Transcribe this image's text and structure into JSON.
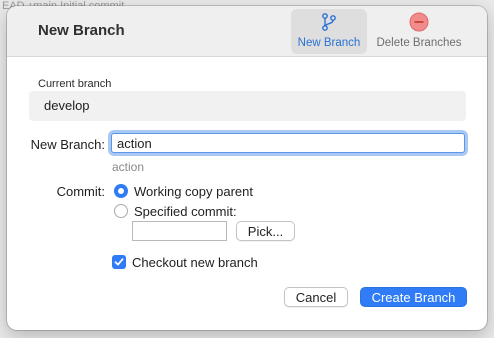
{
  "background": {
    "text": "EAD  ↑main  Initial commit"
  },
  "dialog": {
    "title": "New Branch",
    "toolbar": [
      {
        "label": "New Branch",
        "icon": "branch-icon",
        "active": true
      },
      {
        "label": "Delete Branches",
        "icon": "delete-circle-icon",
        "active": false
      }
    ]
  },
  "current_branch": {
    "label": "Current branch",
    "value": "develop"
  },
  "new_branch": {
    "label": "New Branch:",
    "value": "action",
    "hint": "action"
  },
  "commit": {
    "label": "Commit:",
    "options": [
      {
        "label": "Working copy parent",
        "selected": true
      },
      {
        "label": "Specified commit:",
        "selected": false
      }
    ],
    "commit_value": "",
    "pick_label": "Pick..."
  },
  "checkout": {
    "label": "Checkout new branch",
    "checked": true
  },
  "buttons": {
    "cancel": "Cancel",
    "create": "Create Branch"
  },
  "colors": {
    "accent": "#2f7cf6",
    "delete": "#f07b7b"
  }
}
